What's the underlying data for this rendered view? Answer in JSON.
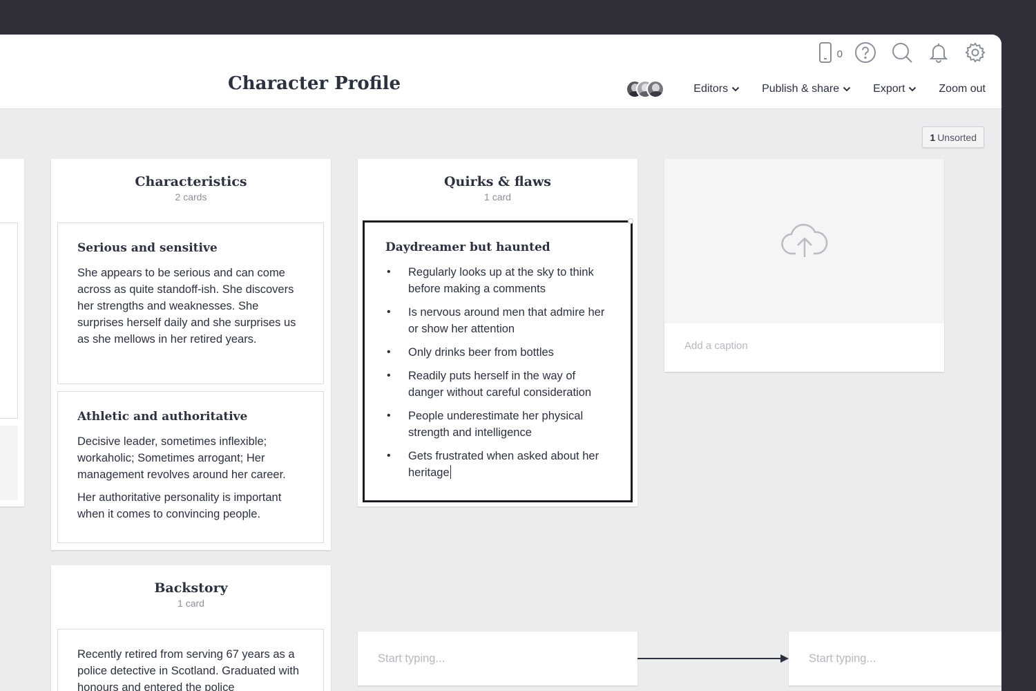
{
  "board": {
    "title": "Character Profile"
  },
  "toolbar": {
    "device_count": "0",
    "editors_label": "Editors",
    "publish_label": "Publish & share",
    "export_label": "Export",
    "zoom_label": "Zoom out"
  },
  "unsorted": {
    "count": "1",
    "label": "Unsorted"
  },
  "columns": [
    {
      "title": "Characteristics",
      "count_label": "2 cards",
      "cards": [
        {
          "title": "Serious and sensitive",
          "paragraphs": [
            "She appears to be serious and can come across as quite standoff-ish. She discovers her strengths and weaknesses. She surprises herself daily and she surprises us as she mellows in her retired years."
          ]
        },
        {
          "title": "Athletic and authoritative",
          "paragraphs": [
            "Decisive leader, sometimes inflexible; workaholic; Sometimes arrogant; Her management revolves around her career.",
            "Her authoritative personality is important when it comes to convincing people."
          ]
        }
      ]
    },
    {
      "title": "Quirks & flaws",
      "count_label": "1 card",
      "cards": [
        {
          "title": "Daydreamer but haunted",
          "bullets": [
            "Regularly looks up at the sky to think before making a comments",
            "Is nervous around men that admire her or show her attention",
            "Only drinks beer from bottles",
            "Readily puts herself in the way of danger without careful consideration",
            "People underestimate her physical strength and intelligence",
            "Gets frustrated when asked about her heritage"
          ]
        }
      ]
    },
    {
      "title": "Backstory",
      "count_label": "1 card",
      "cards": [
        {
          "paragraphs": [
            "Recently retired from serving 67 years as a police detective in Scotland. Graduated with honours and entered the police"
          ]
        }
      ]
    }
  ],
  "image_card": {
    "caption_placeholder": "Add a caption",
    "icon": "cloud-upload-icon"
  },
  "notes": [
    {
      "placeholder": "Start typing..."
    },
    {
      "placeholder": "Start typing..."
    }
  ],
  "colors": {
    "background": "#2f2e39",
    "canvas": "#ebecee",
    "text": "#2c3140",
    "muted": "#8b8f98"
  }
}
